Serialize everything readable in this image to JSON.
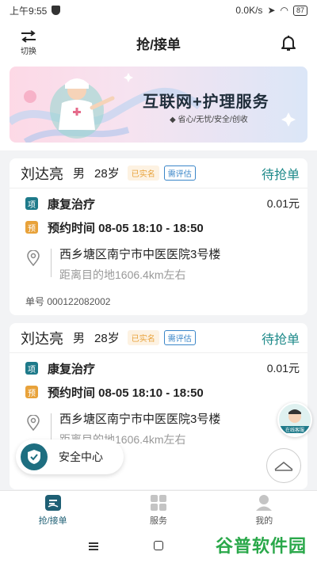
{
  "status_bar": {
    "time": "上午9:55",
    "speed": "0.0K/s",
    "battery": "87"
  },
  "header": {
    "title": "抢/接单",
    "switch_label": "切换"
  },
  "banner": {
    "heading": "互联网+护理服务",
    "subheading": "◆ 省心/无忧/安全/创收"
  },
  "orders": [
    {
      "name": "刘达亮",
      "gender": "男",
      "age": "28岁",
      "tag_verified": "已实名",
      "tag_assess": "需评估",
      "status": "待抢单",
      "service_badge": "项",
      "service": "康复治疗",
      "price": "0.01元",
      "appt_badge": "预",
      "appointment": "预约时间   08-05   18:10 - 18:50",
      "address": "西乡塘区南宁市中医医院3号楼",
      "distance": "距离目的地1606.4km左右",
      "order_no": "单号 000122082002"
    },
    {
      "name": "刘达亮",
      "gender": "男",
      "age": "28岁",
      "tag_verified": "已实名",
      "tag_assess": "需评估",
      "status": "待抢单",
      "service_badge": "项",
      "service": "康复治疗",
      "price": "0.01元",
      "appt_badge": "预",
      "appointment": "预约时间   08-05   18:10 - 18:50",
      "address": "西乡塘区南宁市中医医院3号楼",
      "distance": "距离目的地1606.4km左右"
    }
  ],
  "floating": {
    "safety_center": "安全中心",
    "customer_service": "在线客服"
  },
  "tabs": [
    {
      "label": "抢/接单",
      "icon": "order-icon",
      "active": true
    },
    {
      "label": "服务",
      "icon": "grid-icon",
      "active": false
    },
    {
      "label": "我的",
      "icon": "person-icon",
      "active": false
    }
  ],
  "watermark": {
    "green": "谷普",
    "orange": "软件园"
  },
  "colors": {
    "accent": "#1e8a8a",
    "primary_dark": "#1e5f74",
    "warning": "#e8a23a"
  }
}
